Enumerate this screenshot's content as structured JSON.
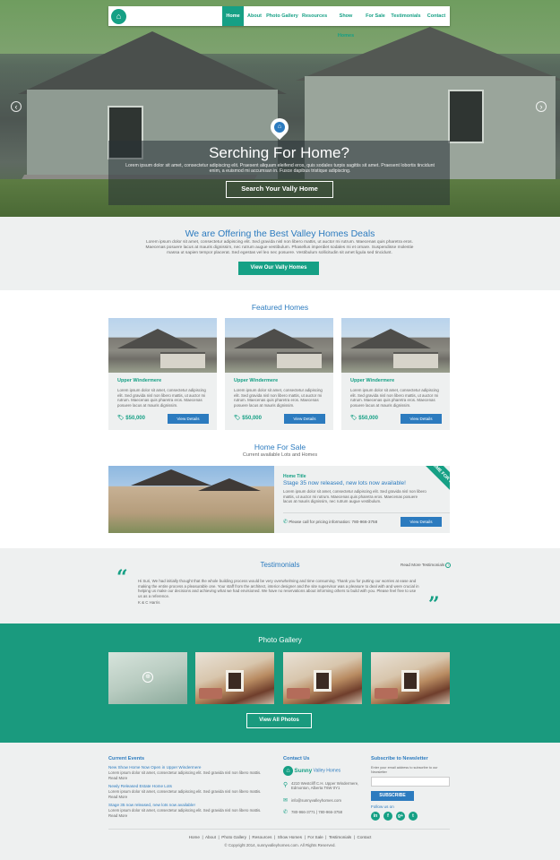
{
  "nav": {
    "items": [
      "Home",
      "About",
      "Photo Gallery",
      "Resources",
      "Show Homes",
      "For Sale",
      "Testimonials",
      "Contact"
    ]
  },
  "hero": {
    "title": "Serching For Home?",
    "text": "Lorem ipsum dolor sit amet, consectetur adipiscing elit. Praesent aliquam eleifend eros, quis sodales turpis sagittis sit amet. Praesent lobortis tincidunt enim, a euismod mi accumsan in. Fusce dapibus tristique adipiscing.",
    "button": "Search Your Vally Home"
  },
  "offer": {
    "title": "We are Offering the Best Valley Homes Deals",
    "text": "Lorem ipsum dolor sit amet, consectetur adipiscing elit. Sed gravida nisl non libero mattis, ut auctor mi rutrum. Maecenas quis pharetra eros. Maecenas posuere lacus at mauris dignissim, nec rutrum augue vestibulum. Phasellus imperdiet sodales mi et ornare. Suspendisse molestie massa ut sapien tempor placerat. Sed egestas vel leo nec posuere. Vestibulum sollicitudin sit amet ligula sed tincidunt.",
    "button": "View Our Vally Homes"
  },
  "featured": {
    "title": "Featured Homes",
    "cards": [
      {
        "title": "Upper Windermere",
        "desc": "Lorem ipsum dolor sit amet, consectetur adipiscing elit. Sed gravida nisl non libero mattis, ut auctor mi rutrum. Maecenas quis pharetra eros. Maecenas posuere lacus at mauris dignissim.",
        "price": "$50,000",
        "button": "View Details"
      },
      {
        "title": "Upper Windermere",
        "desc": "Lorem ipsum dolor sit amet, consectetur adipiscing elit. Sed gravida nisl non libero mattis, ut auctor mi rutrum. Maecenas quis pharetra eros. Maecenas posuere lacus at mauris dignissim.",
        "price": "$50,000",
        "button": "View Details"
      },
      {
        "title": "Upper Windermere",
        "desc": "Lorem ipsum dolor sit amet, consectetur adipiscing elit. Sed gravida nisl non libero mattis, ut auctor mi rutrum. Maecenas quis pharetra eros. Maecenas posuere lacus at mauris dignissim.",
        "price": "$50,000",
        "button": "View Details"
      }
    ]
  },
  "sale": {
    "title": "Home For Sale",
    "subtitle": "Current available Lots and Homes",
    "label": "Home Title",
    "headline": "Stage 35 now released, new lots now available!",
    "desc": "Lorem ipsum dolor sit amet, consectetur adipiscing elit. Sed gravida nisl non libero mattis, ut auctor mi rutrum. Maecenas quis pharetra eros. Maecenas posuere lacus at mauris dignissim, nec rutrum augue vestibulum.",
    "phone": "Please call for pricing information: 780-966-3758",
    "button": "View Details",
    "ribbon": "HOME FOR SALE"
  },
  "testimonials": {
    "title": "Testimonials",
    "more": "Read More Testimonials",
    "text": "Hi Suri, We had initially thought that the whole building process would be very overwhelming and time consuming. Thank you for putting our worries at ease and making the entire process a pleasurable one. Your staff from the architect, interior designer and the site supervisor was a pleasure to deal with and were crucial in helping us make our decisions and achieving what we had envisioned. We have no reservations about informing others to build with you. Please feel free to use us as a reference.",
    "author": "K & C Harris"
  },
  "gallery": {
    "title": "Photo Gallery",
    "button": "View All Photos"
  },
  "footer": {
    "events_title": "Current Events",
    "events": [
      {
        "title": "New Show Home Now Open in Upper Windermere",
        "text": "Lorem ipsum dolor sit amet, consectetur adipiscing elit. Sed gravida nisl non libero mattis.",
        "more": "Read More"
      },
      {
        "title": "Newly Released Estate Home Lots",
        "text": "Lorem ipsum dolor sit amet, consectetur adipiscing elit. Sed gravida nisl non libero mattis.",
        "more": "Read More"
      },
      {
        "title": "Stage 35 now released, new lots now available!",
        "text": "Lorem ipsum dolor sit amet, consectetur adipiscing elit. Sed gravida nisl non libero mattis.",
        "more": "Read More"
      }
    ],
    "contact_title": "Contact Us",
    "brand_bold": "Sunny",
    "brand_rest": "Valley Homes",
    "address": "4210 Westcliff C.H. Upper Windermere, Edmonton, Alberta T6W 0Y1",
    "email": "info@sunnyvalleyhomes.com",
    "phones": "780-966-3771  |  780-966-3758",
    "subscribe_title": "Subscribe to Newsletter",
    "subscribe_text": "Enter your email address to subscribe to our Newsletter",
    "subscribe_button": "SUBSCRIBE",
    "follow": "Follow us on",
    "nav": [
      "Home",
      "About",
      "Photo Gallery",
      "Resources",
      "Show Homes",
      "For Sale",
      "Testimonials",
      "Contact"
    ],
    "copyright": "© Copyright 2014, sunnyvalleyhomes.com. All Rights Reserved."
  },
  "colors": {
    "teal": "#16a085",
    "blue": "#2c7bbf",
    "light_bg": "#eef0f0"
  }
}
